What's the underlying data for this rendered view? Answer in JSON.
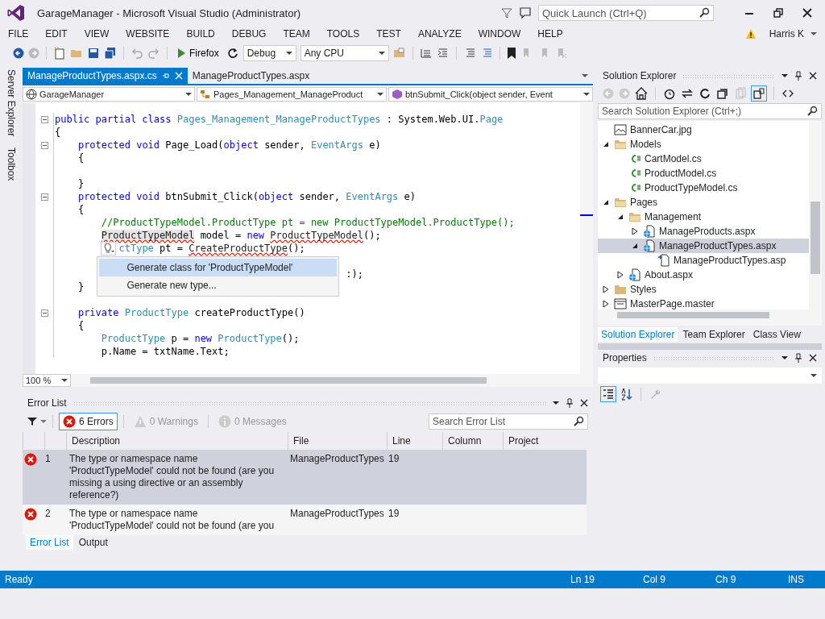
{
  "window": {
    "title": "GarageManager - Microsoft Visual Studio (Administrator)",
    "quick_launch": {
      "placeholder": "Quick Launch (Ctrl+Q)"
    }
  },
  "menu": [
    "FILE",
    "EDIT",
    "VIEW",
    "WEBSITE",
    "BUILD",
    "DEBUG",
    "TEAM",
    "TOOLS",
    "TEST",
    "ANALYZE",
    "WINDOW",
    "HELP"
  ],
  "user": "Harris K",
  "toolbar": {
    "browser": "Firefox",
    "configuration": "Debug",
    "platform": "Any CPU"
  },
  "left_tabs": [
    "Server Explorer",
    "Toolbox"
  ],
  "document_tabs": [
    {
      "label": "ManageProductTypes.aspx.cs",
      "selected": true
    },
    {
      "label": "ManageProductTypes.aspx",
      "selected": false
    }
  ],
  "nav_bar": [
    "GarageManager",
    "Pages_Management_ManageProduct",
    "btnSubmit_Click(object sender, Event"
  ],
  "code": [
    {
      "fold": true,
      "segs": [
        {
          "text": "public partial class",
          "kind": "keyword"
        },
        {
          "text": " Pages_Management_ManageProductTypes",
          "kind": "type"
        },
        {
          "text": " : System.Web.UI.",
          "kind": "plain"
        },
        {
          "text": "Page",
          "kind": "type"
        }
      ]
    },
    {
      "fold": false,
      "segs": [
        {
          "text": "{",
          "kind": "plain"
        }
      ]
    },
    {
      "fold": true,
      "segs": [
        {
          "text": "    protected void",
          "kind": "keyword"
        },
        {
          "text": " Page_Load(",
          "kind": "plain"
        },
        {
          "text": "object",
          "kind": "keyword"
        },
        {
          "text": " sender, ",
          "kind": "plain"
        },
        {
          "text": "EventArgs",
          "kind": "type"
        },
        {
          "text": " e)",
          "kind": "plain"
        }
      ]
    },
    {
      "fold": false,
      "segs": [
        {
          "text": "    {",
          "kind": "plain"
        }
      ]
    },
    {
      "fold": false
    },
    {
      "fold": false,
      "segs": [
        {
          "text": "    }",
          "kind": "plain"
        }
      ]
    },
    {
      "fold": true,
      "segs": [
        {
          "text": "    protected void",
          "kind": "keyword"
        },
        {
          "text": " btnSubmit_Click(",
          "kind": "plain"
        },
        {
          "text": "object",
          "kind": "keyword"
        },
        {
          "text": " sender, ",
          "kind": "plain"
        },
        {
          "text": "EventArgs",
          "kind": "type"
        },
        {
          "text": " e)",
          "kind": "plain"
        }
      ]
    },
    {
      "fold": false,
      "segs": [
        {
          "text": "    {",
          "kind": "plain"
        }
      ]
    },
    {
      "fold": false,
      "segs": [
        {
          "text": "        //ProductTypeModel.ProductType pt = new ProductTypeModel.ProductType();",
          "kind": "comment"
        }
      ]
    },
    {
      "fold": false,
      "segs": [
        {
          "text": "        ProductTypeModel",
          "kind": "error_highlighted"
        },
        {
          "text": " model = ",
          "kind": "plain"
        },
        {
          "text": "new",
          "kind": "keyword"
        },
        {
          "text": " ProductTypeModel",
          "kind": "error"
        },
        {
          "text": "();",
          "kind": "plain"
        }
      ]
    },
    {
      "fold": false,
      "segs": [
        {
          "text": "           ctType",
          "kind": "type"
        },
        {
          "text": " pt = ",
          "kind": "plain"
        },
        {
          "text": "CreateProductType",
          "kind": "error"
        },
        {
          "text": "();",
          "kind": "plain"
        }
      ]
    },
    {
      "fold": false
    },
    {
      "fold": false,
      "segs": [
        {
          "text": "                                                  :);",
          "kind": "plain"
        }
      ]
    },
    {
      "fold": false,
      "segs": [
        {
          "text": "    }",
          "kind": "plain"
        }
      ]
    },
    {
      "fold": false
    },
    {
      "fold": true,
      "segs": [
        {
          "text": "    private",
          "kind": "keyword"
        },
        {
          "text": " ProductType",
          "kind": "type"
        },
        {
          "text": " createProductType()",
          "kind": "plain"
        }
      ]
    },
    {
      "fold": false,
      "segs": [
        {
          "text": "    {",
          "kind": "plain"
        }
      ]
    },
    {
      "fold": false,
      "segs": [
        {
          "text": "        ProductType",
          "kind": "type"
        },
        {
          "text": " p = ",
          "kind": "plain"
        },
        {
          "text": "new",
          "kind": "keyword"
        },
        {
          "text": " ProductType",
          "kind": "type"
        },
        {
          "text": "();",
          "kind": "plain"
        }
      ]
    },
    {
      "fold": false,
      "segs": [
        {
          "text": "        p.Name = txtName.Text;",
          "kind": "plain"
        }
      ]
    }
  ],
  "quick_actions": [
    {
      "label": "Generate class for 'ProductTypeModel'",
      "selected": true
    },
    {
      "label": "Generate new type...",
      "selected": false
    }
  ],
  "zoom": "100 %",
  "error_list": {
    "title": "Error List",
    "filters": [
      {
        "label": "6 Errors",
        "kind": "error",
        "selected": true
      },
      {
        "label": "0 Warnings",
        "kind": "warning",
        "selected": false
      },
      {
        "label": "0 Messages",
        "kind": "info",
        "selected": false
      }
    ],
    "search": {
      "placeholder": "Search Error List"
    },
    "columns": [
      "Description",
      "File",
      "Line",
      "Column",
      "Project"
    ],
    "rows": [
      {
        "number": "1",
        "description": "The type or namespace name 'ProductTypeModel' could not be found (are you missing a using directive or an assembly reference?)",
        "file": "ManageProductTypes",
        "line": "19",
        "selected": true
      },
      {
        "number": "2",
        "description": "The type or namespace name 'ProductTypeModel' could not be found (are you",
        "file": "ManageProductTypes",
        "line": "19",
        "selected": false
      }
    ]
  },
  "bottom_tabs": [
    {
      "label": "Error List",
      "selected": true
    },
    {
      "label": "Output",
      "selected": false
    }
  ],
  "solution_explorer": {
    "title": "Solution Explorer",
    "search": {
      "placeholder": "Search Solution Explorer (Ctrl+;)"
    },
    "tree": [
      {
        "label": "BannerCar.jpg",
        "kind": "image",
        "selected": false
      },
      {
        "label": "Models",
        "kind": "folder",
        "expanded": true,
        "selected": false,
        "children": [
          {
            "label": "CartModel.cs",
            "kind": "cs",
            "selected": false
          },
          {
            "label": "ProductModel.cs",
            "kind": "cs",
            "selected": false
          },
          {
            "label": "ProductTypeModel.cs",
            "kind": "cs",
            "selected": false
          }
        ]
      },
      {
        "label": "Pages",
        "kind": "folder",
        "expanded": true,
        "selected": false,
        "children": [
          {
            "label": "Management",
            "kind": "folder",
            "expanded": true,
            "selected": false,
            "children": [
              {
                "label": "ManageProducts.aspx",
                "kind": "page",
                "expanded": false,
                "selected": false
              },
              {
                "label": "ManageProductTypes.aspx",
                "kind": "page",
                "expanded": true,
                "selected": true,
                "children": [
                  {
                    "label": "ManageProductTypes.asp",
                    "kind": "codebehind",
                    "selected": false
                  }
                ]
              }
            ]
          },
          {
            "label": "About.aspx",
            "kind": "page",
            "expanded": false,
            "selected": false
          }
        ]
      },
      {
        "label": "Styles",
        "kind": "folder",
        "expanded": false,
        "selected": false
      },
      {
        "label": "MasterPage.master",
        "kind": "master",
        "expanded": false,
        "selected": false
      }
    ],
    "tabs": [
      {
        "label": "Solution Explorer",
        "selected": true
      },
      {
        "label": "Team Explorer",
        "selected": false
      },
      {
        "label": "Class View",
        "selected": false
      }
    ]
  },
  "properties": {
    "title": "Properties"
  },
  "status_bar": {
    "message": "Ready",
    "line": "Ln 19",
    "column": "Col 9",
    "char": "Ch 9",
    "mode": "INS"
  }
}
